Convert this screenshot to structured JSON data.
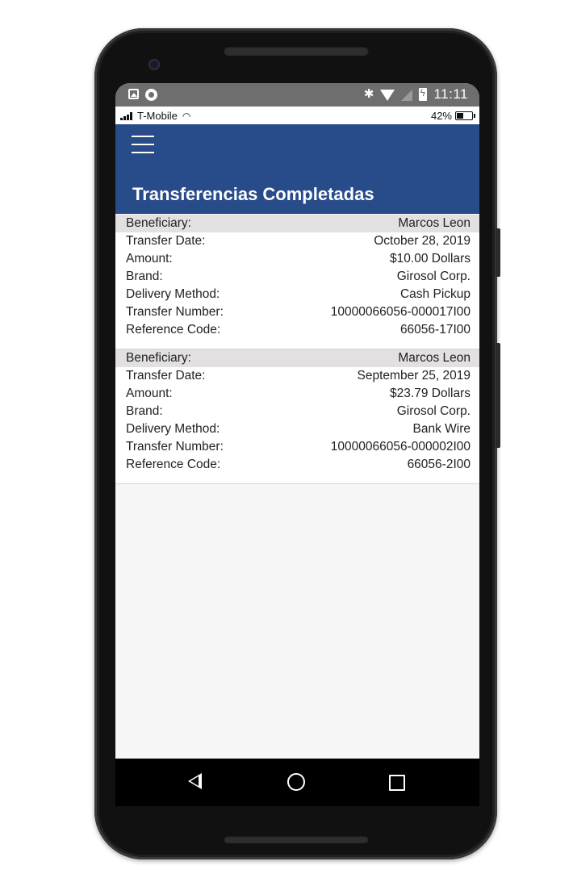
{
  "android_status": {
    "time": "11:11"
  },
  "ios_status": {
    "carrier": "T-Mobile",
    "battery": "42%"
  },
  "header": {
    "title": "Transferencias Completadas",
    "menu_icon": "hamburger-menu-icon"
  },
  "transfers": [
    {
      "rows": [
        {
          "label": "Beneficiary:",
          "value": "Marcos Leon"
        },
        {
          "label": "Transfer Date:",
          "value": "October 28, 2019"
        },
        {
          "label": "Amount:",
          "value": "$10.00 Dollars"
        },
        {
          "label": "Brand:",
          "value": "Girosol Corp."
        },
        {
          "label": "Delivery Method:",
          "value": "Cash Pickup"
        },
        {
          "label": "Transfer Number:",
          "value": "10000066056-000017I00"
        },
        {
          "label": "Reference Code:",
          "value": "66056-17I00"
        }
      ]
    },
    {
      "rows": [
        {
          "label": "Beneficiary:",
          "value": "Marcos Leon"
        },
        {
          "label": "Transfer Date:",
          "value": "September 25, 2019"
        },
        {
          "label": "Amount:",
          "value": "$23.79 Dollars"
        },
        {
          "label": "Brand:",
          "value": "Girosol Corp."
        },
        {
          "label": "Delivery Method:",
          "value": "Bank Wire"
        },
        {
          "label": "Transfer Number:",
          "value": "10000066056-000002I00"
        },
        {
          "label": "Reference Code:",
          "value": "66056-2I00"
        }
      ]
    }
  ],
  "colors": {
    "appbar": "#284c8a",
    "row_header": "#e2e0e0",
    "screen_bg": "#f6f6f6"
  }
}
